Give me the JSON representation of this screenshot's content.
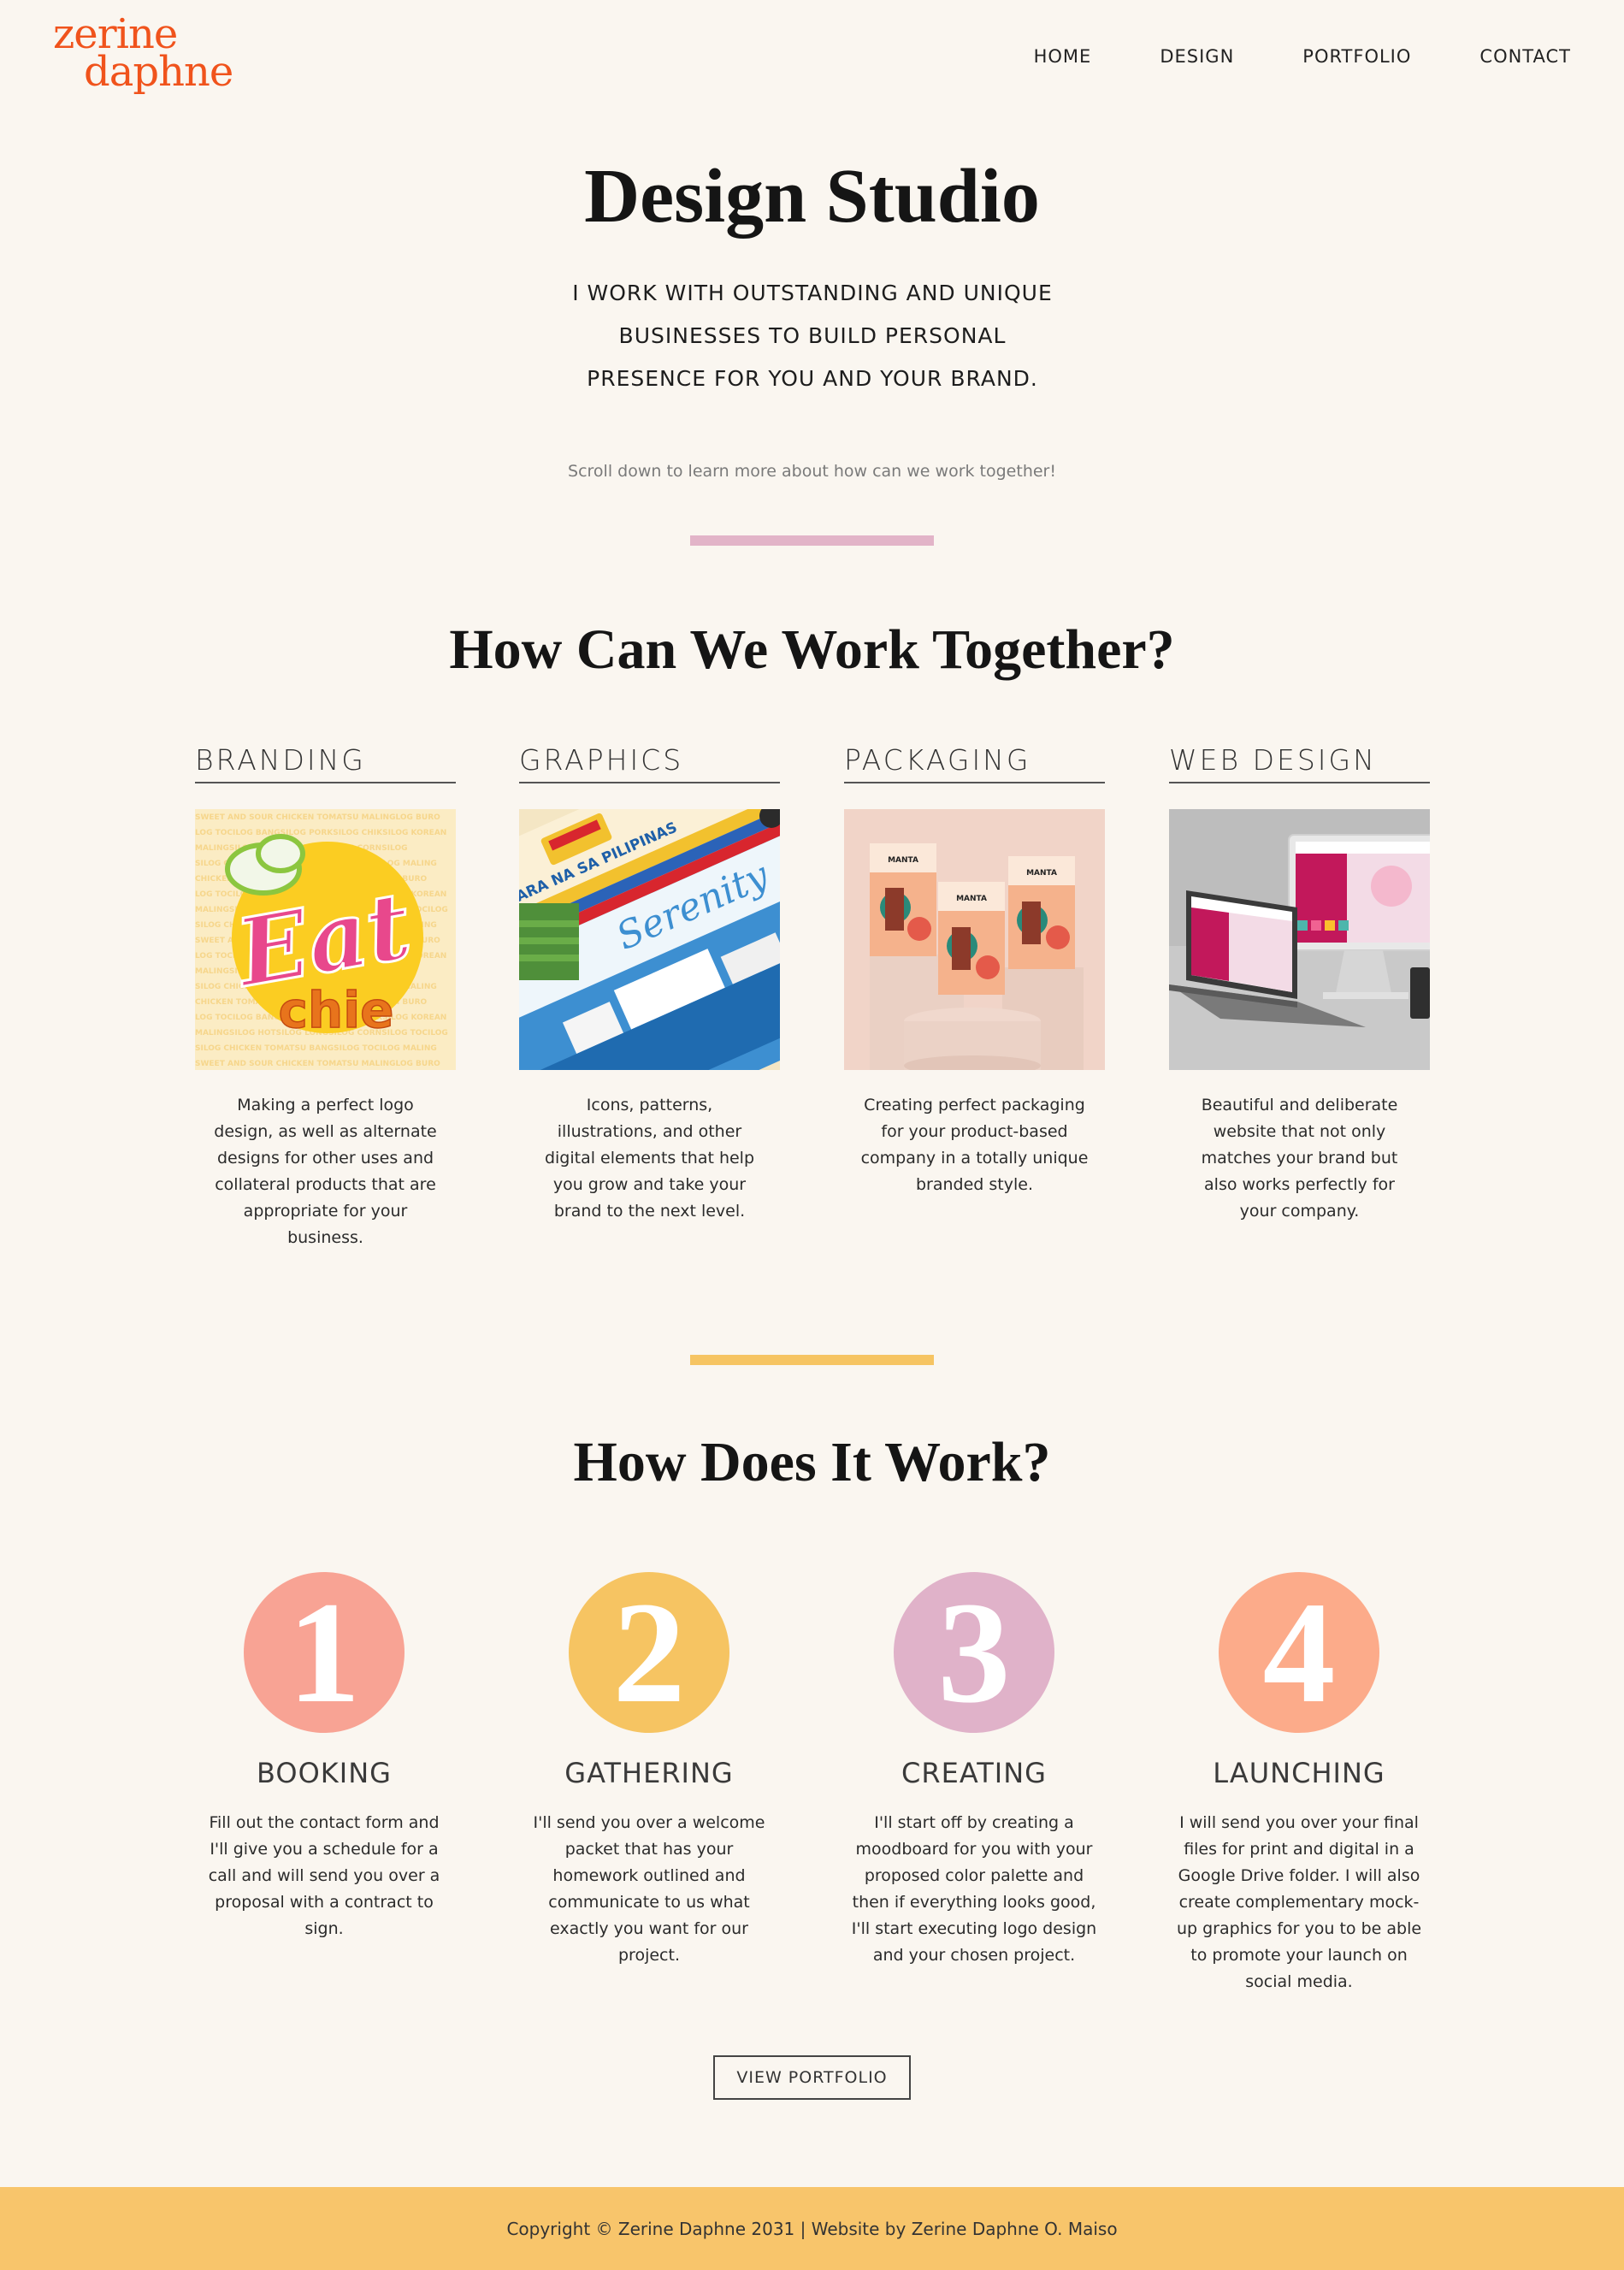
{
  "brand": {
    "line1": "zerine",
    "line2": "daphne",
    "color": "#f0531c"
  },
  "nav": [
    "HOME",
    "DESIGN",
    "PORTFOLIO",
    "CONTACT"
  ],
  "hero": {
    "title": "Design Studio",
    "subtitle": "I WORK WITH OUTSTANDING AND UNIQUE BUSINESSES TO BUILD PERSONAL PRESENCE FOR YOU AND YOUR BRAND.",
    "note": "Scroll down to learn more about how can we work together!"
  },
  "services_section": {
    "title": "How Can We Work Together?",
    "items": [
      {
        "heading": "BRANDING",
        "image": "eat-chie-logo-image",
        "description": "Making a perfect logo design, as well as alternate designs for other uses and collateral products that are appropriate for your business."
      },
      {
        "heading": "GRAPHICS",
        "image": "travel-poster-graphics-image",
        "description": "Icons, patterns, illustrations, and other digital elements that help you grow and take your brand to the next level."
      },
      {
        "heading": "PACKAGING",
        "image": "coffee-packaging-mockup-image",
        "description": "Creating perfect packaging for your product-based company in a totally unique branded style."
      },
      {
        "heading": "WEB DESIGN",
        "image": "laptop-desktop-website-mockup-image",
        "description": "Beautiful and deliberate website that not only matches your brand but also works perfectly for your company."
      }
    ]
  },
  "process_section": {
    "title": "How Does It Work?",
    "steps": [
      {
        "number": "1",
        "title": "BOOKING",
        "color": "#f8a394",
        "description": "Fill out the contact form and I'll give you a schedule for a call and will send you over a proposal with a contract to sign."
      },
      {
        "number": "2",
        "title": "GATHERING",
        "color": "#f6c462",
        "description": "I'll send you over a welcome packet that has your homework outlined and communicate to us what exactly you want for our project."
      },
      {
        "number": "3",
        "title": "CREATING",
        "color": "#e0b2c9",
        "description": "I'll start off by creating a moodboard for you with your proposed color palette and then if everything looks good, I'll start executing logo design and your chosen project."
      },
      {
        "number": "4",
        "title": "LAUNCHING",
        "color": "#fcab8a",
        "description": "I will send you over your final files for print and digital in a Google Drive folder. I will also create complementary mock-up graphics for you to be able to promote your launch on social media."
      }
    ]
  },
  "cta_label": "VIEW PORTFOLIO",
  "footer": {
    "text": "Copyright © Zerine Daphne 2031 | Website by Zerine Daphne O. Maiso"
  },
  "image_text": {
    "eat": "Eat",
    "chie": "chie",
    "tara": "TARA NA SA PILIPINAS",
    "serenity": "Serenity",
    "manta": "MANTA"
  }
}
